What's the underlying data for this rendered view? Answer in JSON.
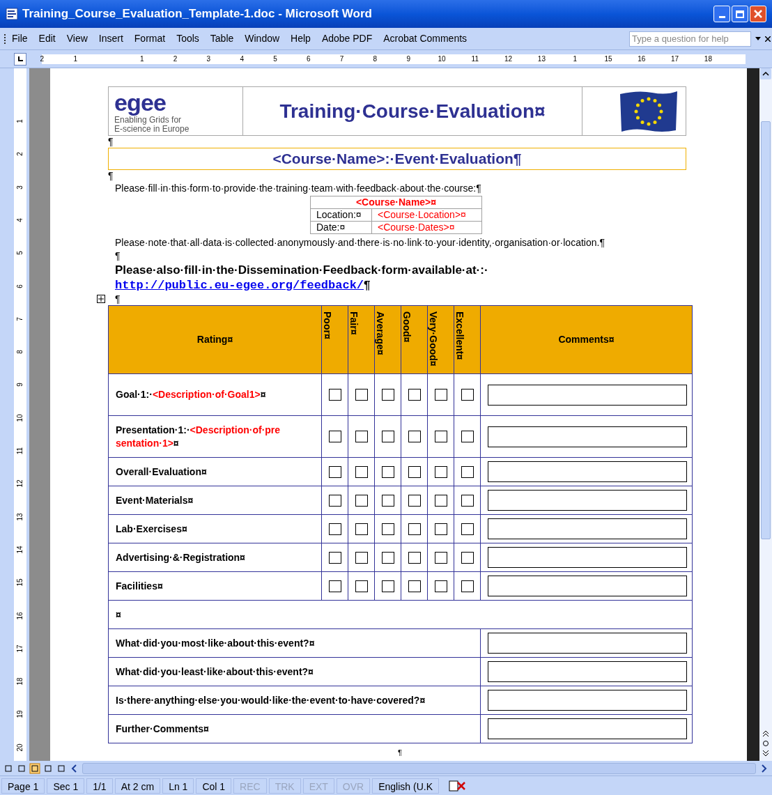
{
  "window": {
    "title": "Training_Course_Evaluation_Template-1.doc - Microsoft Word"
  },
  "menu": [
    "File",
    "Edit",
    "View",
    "Insert",
    "Format",
    "Tools",
    "Table",
    "Window",
    "Help",
    "Adobe PDF",
    "Acrobat Comments"
  ],
  "help_box": {
    "placeholder": "Type a question for help"
  },
  "ruler": {
    "labels": [
      "2",
      "1",
      "1",
      "2",
      "3",
      "4",
      "5",
      "6",
      "7",
      "8",
      "9",
      "10",
      "11",
      "12",
      "13",
      "1",
      "15",
      "16",
      "17",
      "18"
    ],
    "vertical_labels": [
      "1",
      "2",
      "3",
      "4",
      "5",
      "6",
      "7",
      "8",
      "9",
      "10",
      "11",
      "12",
      "13",
      "14",
      "15",
      "16",
      "17",
      "18",
      "19",
      "20"
    ]
  },
  "document": {
    "header": {
      "logo_word": "egee",
      "tagline": [
        "Enabling Grids for",
        "E-science in Europe"
      ],
      "title": "Training·Course·Evaluation¤"
    },
    "pilcrow_1": "¶",
    "banner": "<Course·Name>:·Event·Evaluation¶",
    "pilcrow_2": "¶",
    "intro": "Please·fill·in·this·form·to·provide·the·training·team·with·feedback·about·the·course:¶",
    "info_table": {
      "course_name": "<Course·Name>¤",
      "rows": [
        {
          "label": "Location:¤",
          "value": "<Course·Location>¤"
        },
        {
          "label": "Date:¤",
          "value": "<Course·Dates>¤"
        }
      ]
    },
    "note": "Please·note·that·all·data·is·collected·anonymously·and·there·is·no·link·to·your·identity,·organisation·or·location.¶",
    "pilcrow_3": "¶",
    "dissemination": "Please·also·fill·in·the·Dissemination·Feedback·form·available·at·:·",
    "link": "http://public.eu-egee.org/feedback/",
    "link_mark": "¶",
    "pilcrow_4": "¶",
    "table": {
      "rating_heading": "Rating¤",
      "scales": [
        "Poor¤",
        "Fair¤",
        "Average¤",
        "Good¤",
        "Very·Good¤",
        "Excellent¤"
      ],
      "comments_heading": "Comments¤",
      "rows": [
        {
          "label": "Goal·1:·",
          "description": "<Description·of·Goal1>",
          "end_mark": "¤",
          "checked": [
            false,
            false,
            false,
            false,
            false,
            false
          ]
        },
        {
          "label": "Presentation·1:·",
          "description": "<Description·of·presentation·1>",
          "end_mark": "¤",
          "checked": [
            false,
            false,
            false,
            false,
            false,
            false
          ]
        },
        {
          "label": "Overall·Evaluation¤",
          "checked": [
            false,
            false,
            false,
            false,
            false,
            false
          ]
        },
        {
          "label": "Event·Materials¤",
          "checked": [
            false,
            false,
            false,
            false,
            false,
            false
          ]
        },
        {
          "label": "Lab·Exercises¤",
          "checked": [
            false,
            false,
            false,
            false,
            false,
            false
          ]
        },
        {
          "label": "Advertising·&·Registration¤",
          "checked": [
            false,
            false,
            false,
            false,
            false,
            false
          ]
        },
        {
          "label": "Facilities¤",
          "checked": [
            false,
            false,
            false,
            false,
            false,
            false
          ]
        }
      ],
      "blank_row": "¤",
      "questions": [
        "What·did·you·most·like·about·this·event?¤",
        "What·did·you·least·like·about·this·event?¤",
        "Is·there·anything·else·you·would·like·the·event·to·have·covered?¤",
        "Further·Comments¤"
      ]
    },
    "end_mark": "¶"
  },
  "status_bar": [
    {
      "text": "Page 1",
      "disabled": false
    },
    {
      "text": "Sec 1",
      "disabled": false
    },
    {
      "text": "1/1",
      "disabled": false
    },
    {
      "text": "At 2 cm",
      "disabled": false
    },
    {
      "text": "Ln 1",
      "disabled": false
    },
    {
      "text": "Col 1",
      "disabled": false
    },
    {
      "text": "REC",
      "disabled": true
    },
    {
      "text": "TRK",
      "disabled": true
    },
    {
      "text": "EXT",
      "disabled": true
    },
    {
      "text": "OVR",
      "disabled": true
    },
    {
      "text": "English (U.K",
      "disabled": false
    }
  ]
}
